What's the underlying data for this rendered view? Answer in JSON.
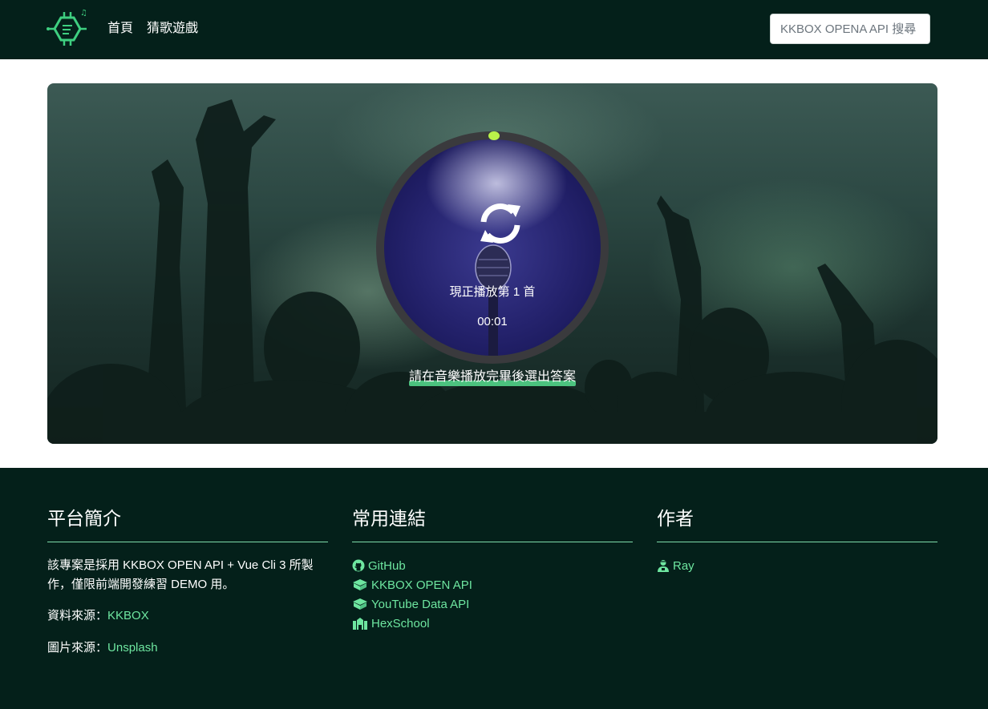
{
  "nav": {
    "home": "首頁",
    "game": "猜歌遊戲",
    "search_placeholder": "KKBOX OPENA API 搜尋"
  },
  "player": {
    "now_playing": "現正播放第 1 首",
    "time": "00:01",
    "hint": "請在音樂播放完畢後選出答案",
    "progress_fraction": 0.0
  },
  "footer": {
    "about": {
      "title": "平台簡介",
      "text": "該專案是採用 KKBOX OPEN API + Vue Cli 3 所製作，僅限前端開發練習 DEMO 用。",
      "data_source_label": "資料來源：",
      "data_source_link": "KKBOX",
      "image_source_label": "圖片來源：",
      "image_source_link": "Unsplash"
    },
    "links": {
      "title": "常用連結",
      "items": [
        {
          "label": "GitHub",
          "icon": "github-icon"
        },
        {
          "label": "KKBOX OPEN API",
          "icon": "box-icon"
        },
        {
          "label": "YouTube Data API",
          "icon": "box-icon"
        },
        {
          "label": "HexSchool",
          "icon": "school-icon"
        }
      ]
    },
    "author": {
      "title": "作者",
      "name": "Ray",
      "icon": "user-icon"
    }
  },
  "colors": {
    "dark_green": "#04201a",
    "accent_green": "#6ee6a0",
    "progress_dot": "#b9f24a"
  }
}
